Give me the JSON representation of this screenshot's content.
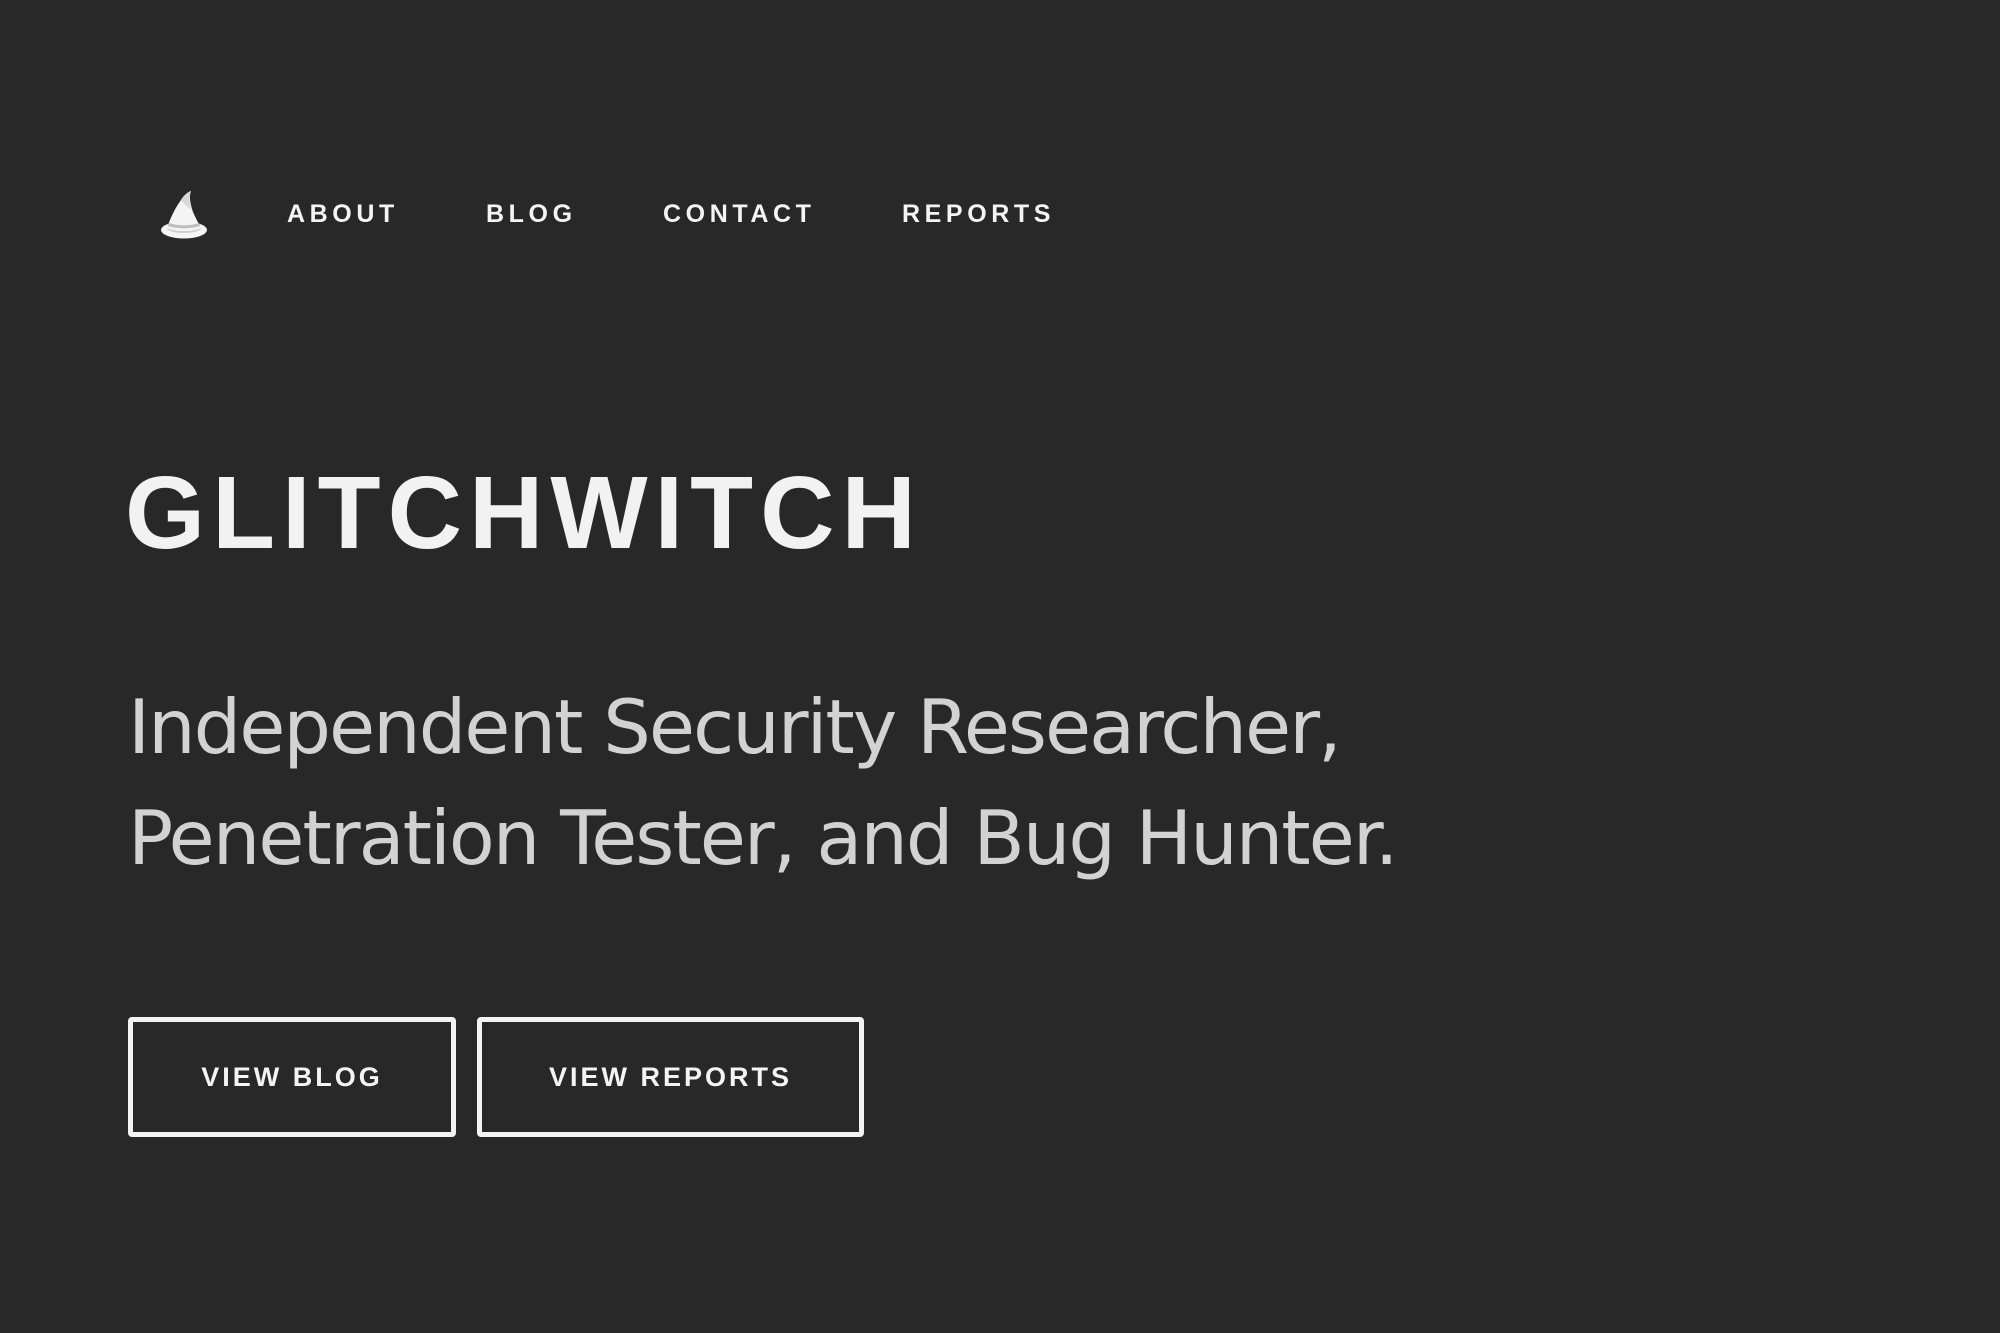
{
  "nav": {
    "logo_icon": "witch-hat-icon",
    "items": [
      {
        "label": "ABOUT"
      },
      {
        "label": "BLOG"
      },
      {
        "label": "CONTACT"
      },
      {
        "label": "REPORTS"
      }
    ]
  },
  "hero": {
    "title": "GLITCHWITCH",
    "tagline_lines": [
      "Independent Security Researcher,",
      "Penetration Tester, and Bug Hunter."
    ]
  },
  "actions": {
    "view_blog_label": "VIEW BLOG",
    "view_reports_label": "VIEW REPORTS"
  },
  "colors": {
    "background": "#282828",
    "text": "#f2f2f2",
    "tagline": "#d2d2d2",
    "button_border": "#f3f3f3"
  }
}
